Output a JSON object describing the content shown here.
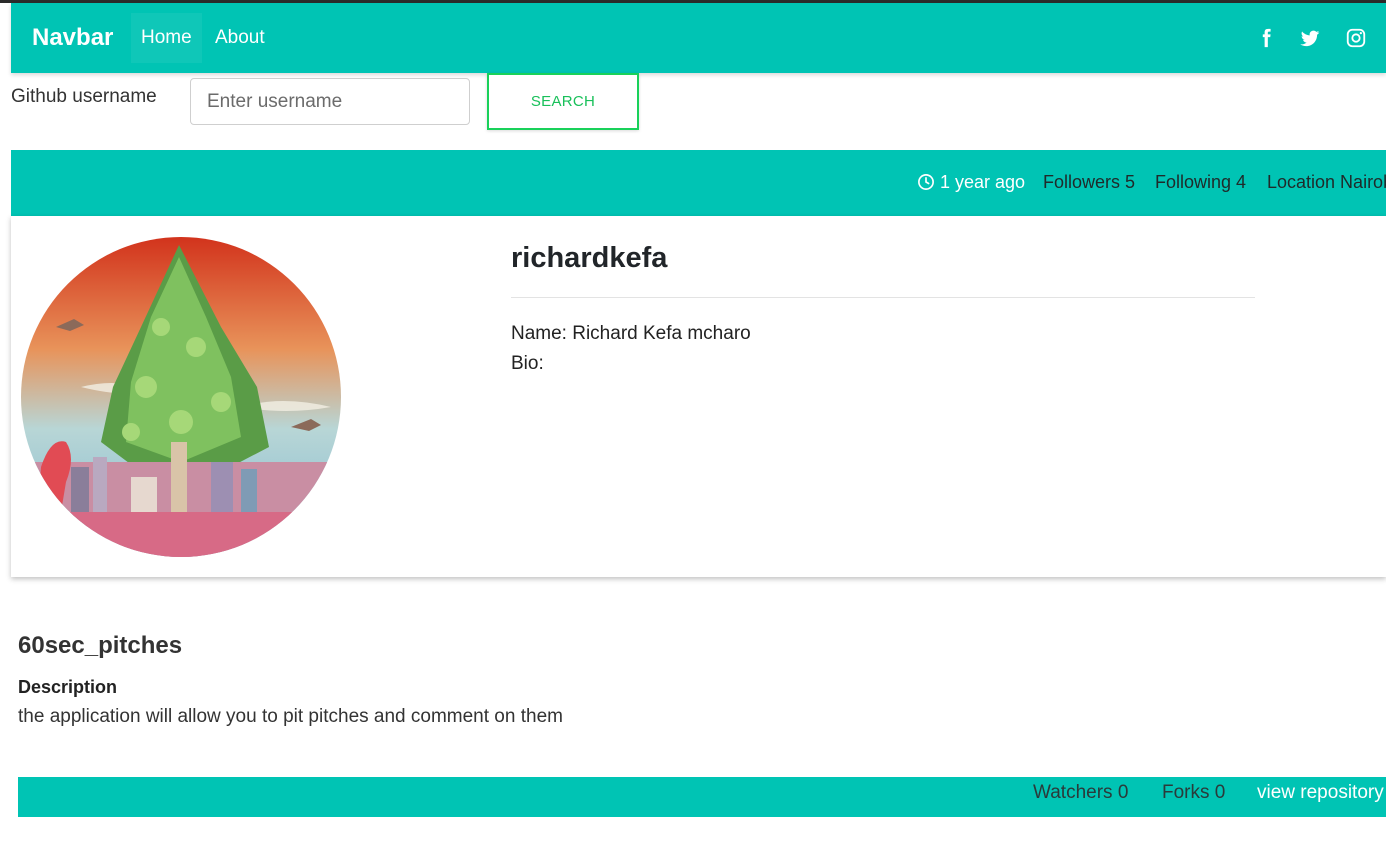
{
  "navbar": {
    "brand": "Navbar",
    "links": [
      {
        "label": "Home",
        "active": true
      },
      {
        "label": "About",
        "active": false
      }
    ],
    "social_icons": [
      "facebook-icon",
      "twitter-icon",
      "instagram-icon"
    ],
    "color": "#00c4b4"
  },
  "search": {
    "label": "Github username",
    "placeholder": "Enter username",
    "value": "",
    "button_label": "SEARCH",
    "button_color": "#19d15a"
  },
  "stats": {
    "created": "1 year ago",
    "followers": "Followers 5",
    "following": "Following 4",
    "location": "Location Nairobi"
  },
  "profile": {
    "username": "richardkefa",
    "name": "Name: Richard Kefa mcharo",
    "bio": "Bio:"
  },
  "repo": {
    "name": "60sec_pitches",
    "description_label": "Description",
    "description": "the application will allow you to pit pitches and comment on them",
    "watchers": "Watchers 0",
    "forks": "Forks 0",
    "view_link": "view repository"
  }
}
